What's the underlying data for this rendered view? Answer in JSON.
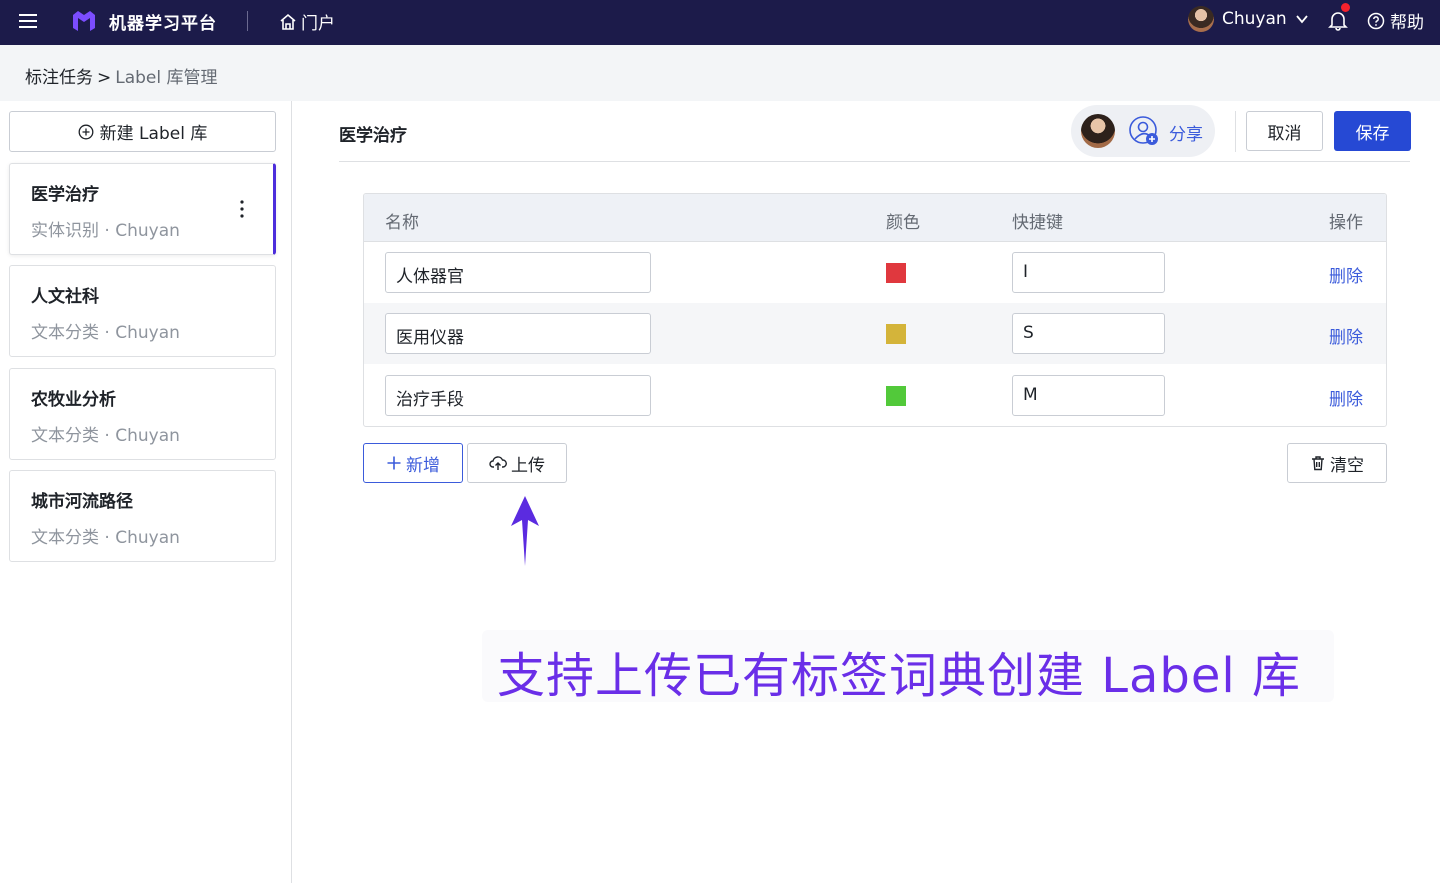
{
  "topbar": {
    "app_title": "机器学习平台",
    "home_label": "门户",
    "user_name": "Chuyan",
    "help_label": "帮助",
    "icons": [
      "menu-icon",
      "logo-icon",
      "home-icon",
      "chevron-down-icon",
      "bell-icon",
      "help-icon"
    ]
  },
  "breadcrumb": {
    "root": "标注任务",
    "separator": ">",
    "current": "Label 库管理"
  },
  "sidebar": {
    "new_button_label": "新建 Label 库",
    "libraries": [
      {
        "name": "医学治疗",
        "meta": "实体识别 · Chuyan",
        "active": true
      },
      {
        "name": "人文社科",
        "meta": "文本分类 · Chuyan",
        "active": false
      },
      {
        "name": "农牧业分析",
        "meta": "文本分类 · Chuyan",
        "active": false
      },
      {
        "name": "城市河流路径",
        "meta": "文本分类 · Chuyan",
        "active": false
      }
    ]
  },
  "main": {
    "title": "医学治疗",
    "share_label": "分享",
    "cancel_label": "取消",
    "save_label": "保存",
    "table": {
      "headers": {
        "name": "名称",
        "color": "颜色",
        "shortcut": "快捷键",
        "action": "操作"
      },
      "rows": [
        {
          "name": "人体器官",
          "color": "#e0383e",
          "shortcut": "I",
          "action": "删除"
        },
        {
          "name": "医用仪器",
          "color": "#d4b43a",
          "shortcut": "S",
          "action": "删除"
        },
        {
          "name": "治疗手段",
          "color": "#52c93a",
          "shortcut": "M",
          "action": "删除"
        }
      ]
    },
    "add_label": "新增",
    "upload_label": "上传",
    "clear_label": "清空"
  },
  "annotation": {
    "text": "支持上传已有标签词典创建 Label 库",
    "color": "#6a2ee8"
  },
  "colors": {
    "topbar_bg": "#1c1b4a",
    "primary": "#2649d4",
    "link": "#3b5bdb",
    "active_accent": "#4c2ddb"
  }
}
